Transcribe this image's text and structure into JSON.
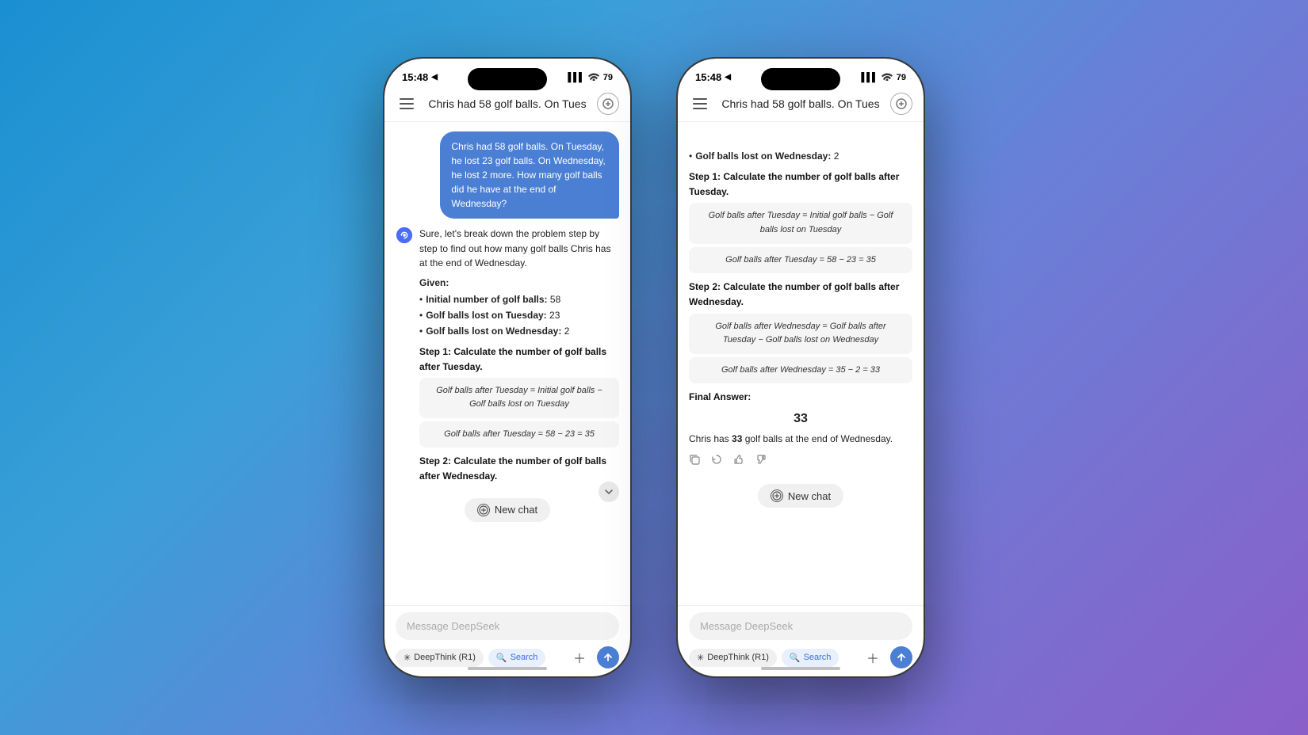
{
  "phone1": {
    "statusBar": {
      "time": "15:48",
      "locationIcon": "▶",
      "signalIcon": "|||",
      "wifiIcon": "wifi",
      "battery": "79"
    },
    "header": {
      "title": "Chris had 58 golf balls. On Tues",
      "menuIcon": "≡",
      "newIcon": "+"
    },
    "userMessage": "Chris had 58 golf balls. On Tuesday, he lost 23 golf balls. On Wednesday, he lost 2 more. How many golf balls did he have at the end of Wednesday?",
    "aiIntro": "Sure, let's break down the problem step by step to find out how many golf balls Chris has at the end of Wednesday.",
    "givenLabel": "Given:",
    "bulletItems": [
      {
        "label": "Initial number of golf balls:",
        "value": "58"
      },
      {
        "label": "Golf balls lost on Tuesday:",
        "value": "23"
      },
      {
        "label": "Golf balls lost on Wednesday:",
        "value": "2"
      }
    ],
    "step1": {
      "heading": "Step 1: Calculate the number of golf balls after Tuesday.",
      "formula1": "Golf balls after Tuesday = Initial golf balls − Golf balls lost on Tuesday",
      "formula2": "Golf balls after Tuesday = 58 − 23 = 35"
    },
    "step2Heading": "Step 2: Calculate the number of golf balls after Wednesday.",
    "newChatLabel": "New chat",
    "messagePlaceholder": "Message DeepSeek",
    "deepThinkLabel": "DeepThink (R1)",
    "searchLabel": "Search",
    "scrollDownVisible": true
  },
  "phone2": {
    "statusBar": {
      "time": "15:48",
      "locationIcon": "▶",
      "signalIcon": "|||",
      "wifiIcon": "wifi",
      "battery": "79"
    },
    "header": {
      "title": "Chris had 58 golf balls. On Tues",
      "menuIcon": "≡",
      "newIcon": "+"
    },
    "scrolledContent": {
      "continuedBullet": "Golf balls lost on Wednesday: 2",
      "step1Heading": "Step 1: Calculate the number of golf balls after Tuesday.",
      "step1Formula1": "Golf balls after Tuesday = Initial golf balls − Golf balls lost on Tuesday",
      "step1Formula2": "Golf balls after Tuesday = 58 − 23 = 35",
      "step2Heading": "Step 2: Calculate the number of golf balls after Wednesday.",
      "step2Formula1": "Golf balls after Wednesday = Golf balls after Tuesday − Golf balls lost on Wednesday",
      "step2Formula2": "Golf balls after Wednesday = 35 − 2 = 33",
      "finalAnswerLabel": "Final Answer:",
      "finalNumber": "33",
      "finalText": "Chris has 33 golf balls at the end of Wednesday."
    },
    "feedbackIcons": [
      "↩",
      "↺",
      "👍",
      "👎"
    ],
    "newChatLabel": "New chat",
    "messagePlaceholder": "Message DeepSeek",
    "deepThinkLabel": "DeepThink (R1)",
    "searchLabel": "Search"
  }
}
